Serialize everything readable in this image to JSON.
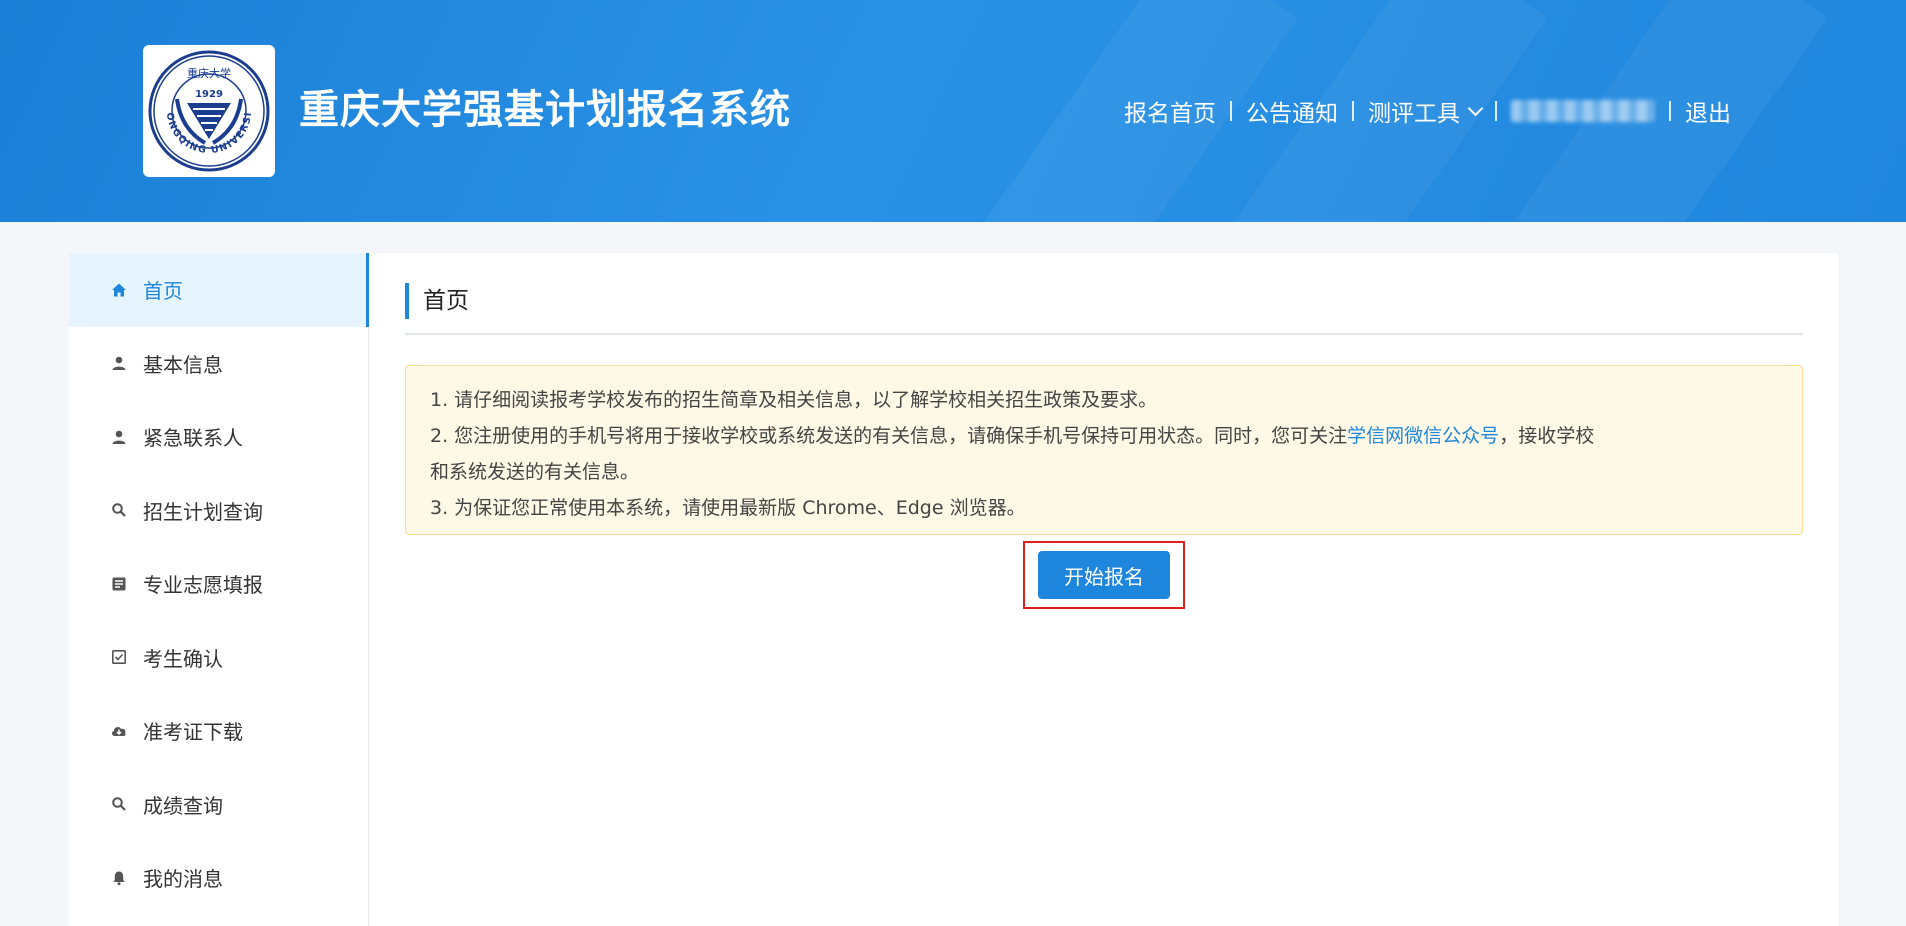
{
  "colors": {
    "primary": "#1f86dd",
    "highlight_border": "#e0221c",
    "notice_bg": "#fef8e6"
  },
  "header": {
    "logo": {
      "text_top": "重庆大学",
      "year": "1929",
      "text_ring": "CHONGQING UNIVERSITY"
    },
    "title": "重庆大学强基计划报名系统",
    "nav": {
      "home": "报名首页",
      "notice": "公告通知",
      "tools": "测评工具",
      "logout": "退出"
    }
  },
  "sidebar": {
    "items": [
      {
        "label": "首页",
        "icon": "home-icon"
      },
      {
        "label": "基本信息",
        "icon": "user-icon"
      },
      {
        "label": "紧急联系人",
        "icon": "user-icon"
      },
      {
        "label": "招生计划查询",
        "icon": "search-icon"
      },
      {
        "label": "专业志愿填报",
        "icon": "document-icon"
      },
      {
        "label": "考生确认",
        "icon": "checkbox-icon"
      },
      {
        "label": "准考证下载",
        "icon": "cloud-download-icon"
      },
      {
        "label": "成绩查询",
        "icon": "search-icon"
      },
      {
        "label": "我的消息",
        "icon": "bell-icon"
      }
    ]
  },
  "main": {
    "title": "首页",
    "notice": {
      "line1": "1. 请仔细阅读报考学校发布的招生简章及相关信息，以了解学校相关招生政策及要求。",
      "line2_a": "2. 您注册使用的手机号将用于接收学校或系统发送的有关信息，请确保手机号保持可用状态。同时，您可关注",
      "line2_link": "学信网微信公众号",
      "line2_b": "，接收学校",
      "line2_c": "和系统发送的有关信息。",
      "line3": "3. 为保证您正常使用本系统，请使用最新版 Chrome、Edge 浏览器。"
    },
    "start_button": "开始报名"
  }
}
